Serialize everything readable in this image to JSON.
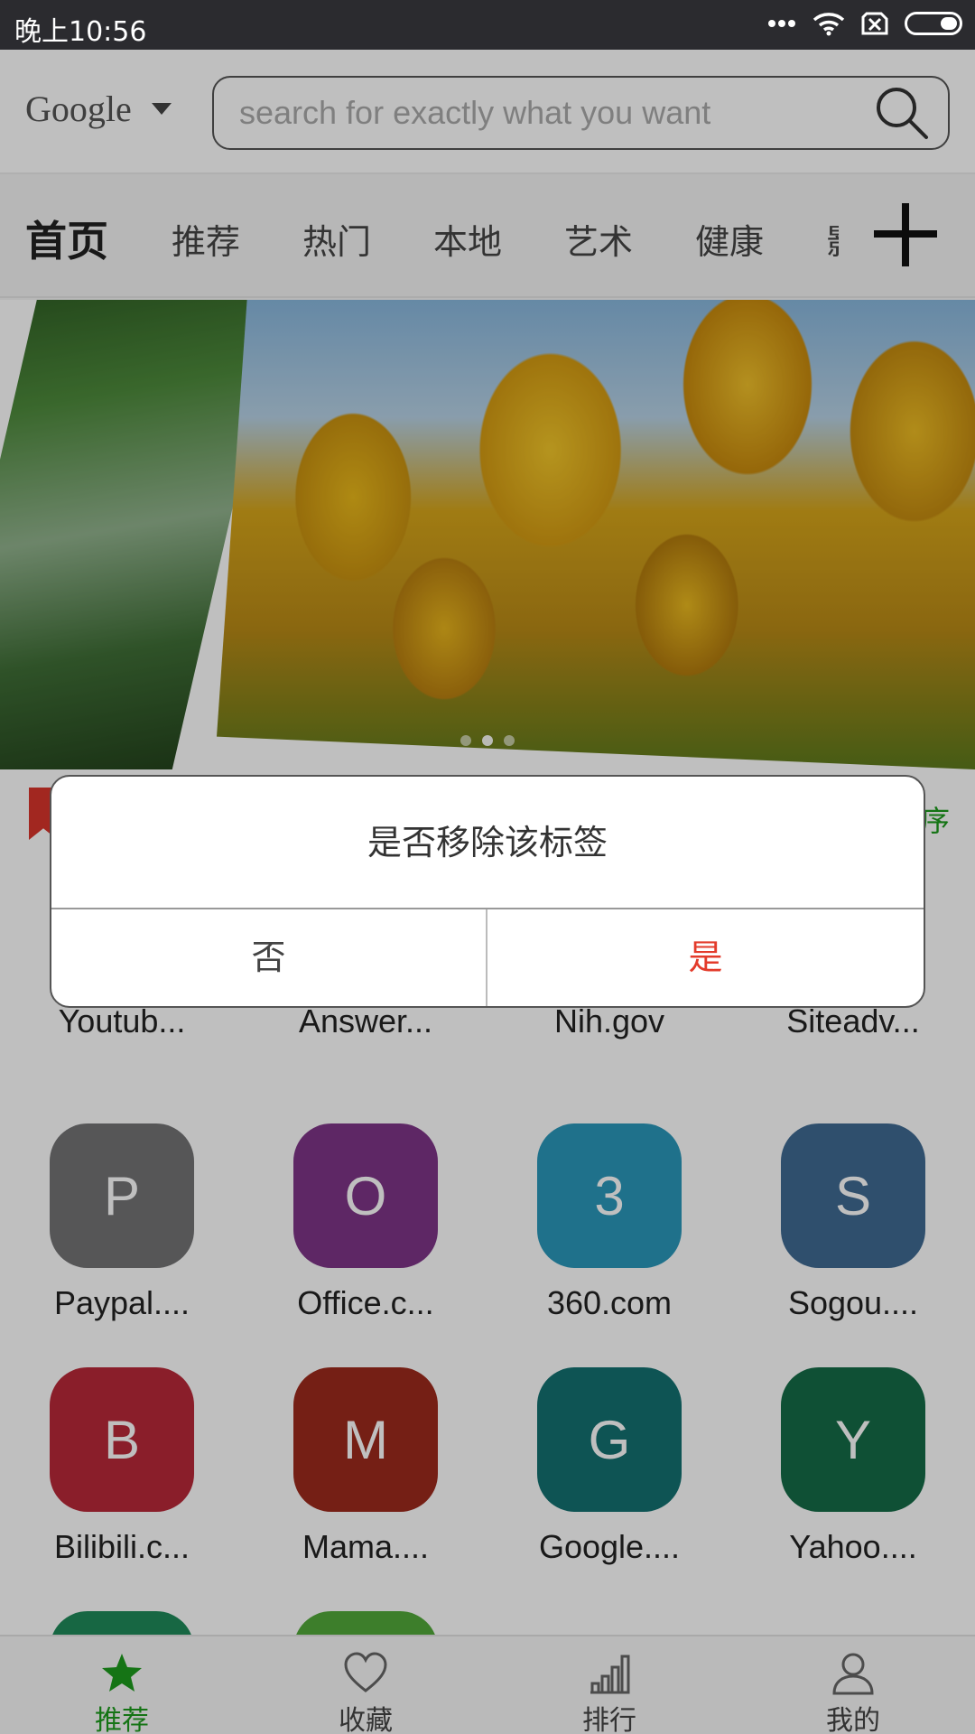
{
  "status_bar": {
    "time": "晚上10:56",
    "icons": [
      "more-icon",
      "wifi-icon",
      "sim-disabled-icon",
      "battery-icon"
    ]
  },
  "search": {
    "engine": "Google",
    "placeholder": "search for exactly what you want"
  },
  "tabs": [
    "首页",
    "推荐",
    "热门",
    "本地",
    "艺术",
    "健康",
    "影"
  ],
  "banner": {
    "page_count": 3,
    "active_page": 2
  },
  "section": {
    "sort_label": "序"
  },
  "apps": [
    {
      "letter": "",
      "name": "Youtub...",
      "color": "#c4342d"
    },
    {
      "letter": "",
      "name": "Answer...",
      "color": "#3f6f5c"
    },
    {
      "letter": "",
      "name": "Nih.gov",
      "color": "#4d8a70"
    },
    {
      "letter": "",
      "name": "Siteadv...",
      "color": "#8a8a8a"
    },
    {
      "letter": "P",
      "name": "Paypal....",
      "color": "#737375"
    },
    {
      "letter": "O",
      "name": "Office.c...",
      "color": "#7e3587"
    },
    {
      "letter": "3",
      "name": "360.com",
      "color": "#2a97ba"
    },
    {
      "letter": "S",
      "name": "Sogou....",
      "color": "#3f6a92"
    },
    {
      "letter": "B",
      "name": "Bilibili.c...",
      "color": "#b82939"
    },
    {
      "letter": "M",
      "name": "Mama....",
      "color": "#9c2a1d"
    },
    {
      "letter": "G",
      "name": "Google....",
      "color": "#137070"
    },
    {
      "letter": "Y",
      "name": "Yahoo....",
      "color": "#156b47"
    },
    {
      "letter": "",
      "name": "",
      "color": "#1f8a5a"
    },
    {
      "letter": "",
      "name": "",
      "color": "#52a83a"
    }
  ],
  "dialog": {
    "message": "是否移除该标签",
    "no_label": "否",
    "yes_label": "是"
  },
  "bottom_nav": [
    {
      "label": "推荐",
      "icon": "star-icon",
      "active": true
    },
    {
      "label": "收藏",
      "icon": "heart-icon",
      "active": false
    },
    {
      "label": "排行",
      "icon": "bar-chart-icon",
      "active": false
    },
    {
      "label": "我的",
      "icon": "user-icon",
      "active": false
    }
  ],
  "colors": {
    "accent_green": "#1c9b1c",
    "confirm_red": "#e33b2b",
    "status_bar": "#2b2b2f"
  }
}
